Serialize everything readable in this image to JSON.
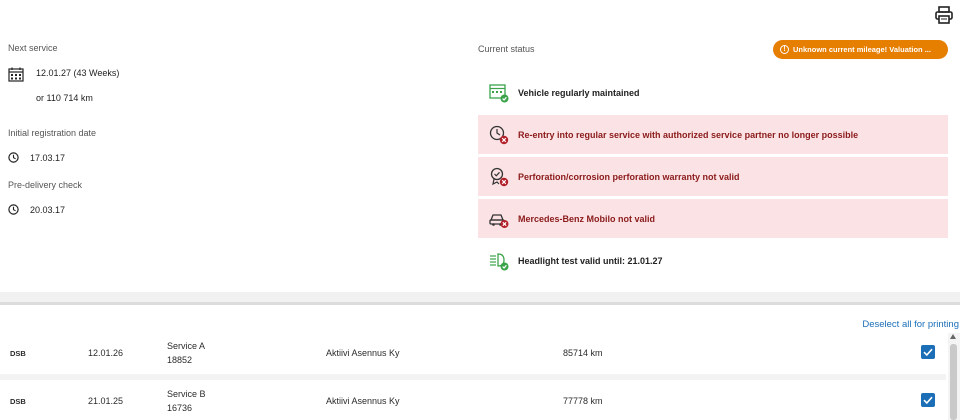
{
  "toolbar": {
    "print_icon": "printer-icon"
  },
  "service_info": {
    "next_service_label": "Next service",
    "next_service_date": "12.01.27 (43 Weeks)",
    "next_service_km": "or 110 714 km",
    "initial_registration_label": "Initial registration date",
    "initial_registration_date": "17.03.17",
    "pre_delivery_label": "Pre-delivery check",
    "pre_delivery_date": "20.03.17"
  },
  "status": {
    "title": "Current status",
    "mileage_warning": "Unknown current mileage! Valuation ...",
    "items": [
      {
        "label": "Vehicle regularly maintained",
        "state": "ok",
        "icon": "calendar-check-icon"
      },
      {
        "label": "Re-entry into regular service with authorized service partner no longer possible",
        "state": "error",
        "icon": "service-clock-error-icon"
      },
      {
        "label": "Perforation/corrosion perforation warranty not valid",
        "state": "error",
        "icon": "warranty-seal-error-icon"
      },
      {
        "label": "Mercedes-Benz Mobilo not valid",
        "state": "error",
        "icon": "car-error-icon"
      },
      {
        "label": "Headlight test valid until: 21.01.27",
        "state": "ok",
        "icon": "headlight-check-icon"
      }
    ]
  },
  "history": {
    "deselect_label": "Deselect all for printing",
    "rows": [
      {
        "code": "DSB",
        "date": "12.01.26",
        "service": "Service A",
        "service_number": "18852",
        "partner": "Aktiivi Asennus Ky",
        "mileage": "85714 km",
        "checked": true
      },
      {
        "code": "DSB",
        "date": "21.01.25",
        "service": "Service B",
        "service_number": "16736",
        "partner": "Aktiivi Asennus Ky",
        "mileage": "77778 km",
        "checked": true
      }
    ]
  },
  "colors": {
    "accent": "#1c6fb7",
    "warning": "#e67e00",
    "error_bg": "#fbe3e5",
    "error_text": "#8b1a1a",
    "ok_green": "#3aa34a"
  }
}
